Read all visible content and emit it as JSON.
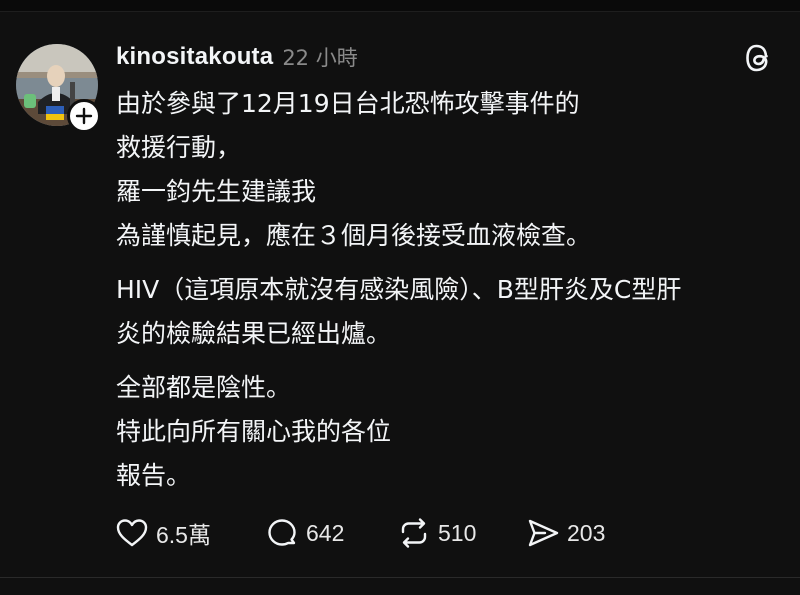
{
  "post": {
    "username": "kinositakouta",
    "timestamp": "22 小時",
    "paragraphs": [
      [
        "由於參與了12月19日台北恐怖攻擊事件的",
        "救援行動，",
        "羅一鈞先生建議我",
        "為謹慎起見，應在３個月後接受血液檢查。"
      ],
      [
        "HIV（這項原本就沒有感染風險）、B型肝炎及C型肝",
        "炎的檢驗結果已經出爐。"
      ],
      [
        "全部都是陰性。",
        "特此向所有關心我的各位",
        "報告。"
      ]
    ]
  },
  "actions": {
    "likes": "6.5萬",
    "replies": "642",
    "reposts": "510",
    "shares": "203"
  },
  "icons": {
    "avatar": "profile-photo",
    "follow": "plus-icon",
    "app": "threads-logo-icon",
    "like": "heart-icon",
    "reply": "speech-bubble-icon",
    "repost": "repost-arrows-icon",
    "share": "send-icon"
  },
  "colors": {
    "background": "#101010",
    "text": "#f3f5f7",
    "muted": "#8a8a8a"
  }
}
